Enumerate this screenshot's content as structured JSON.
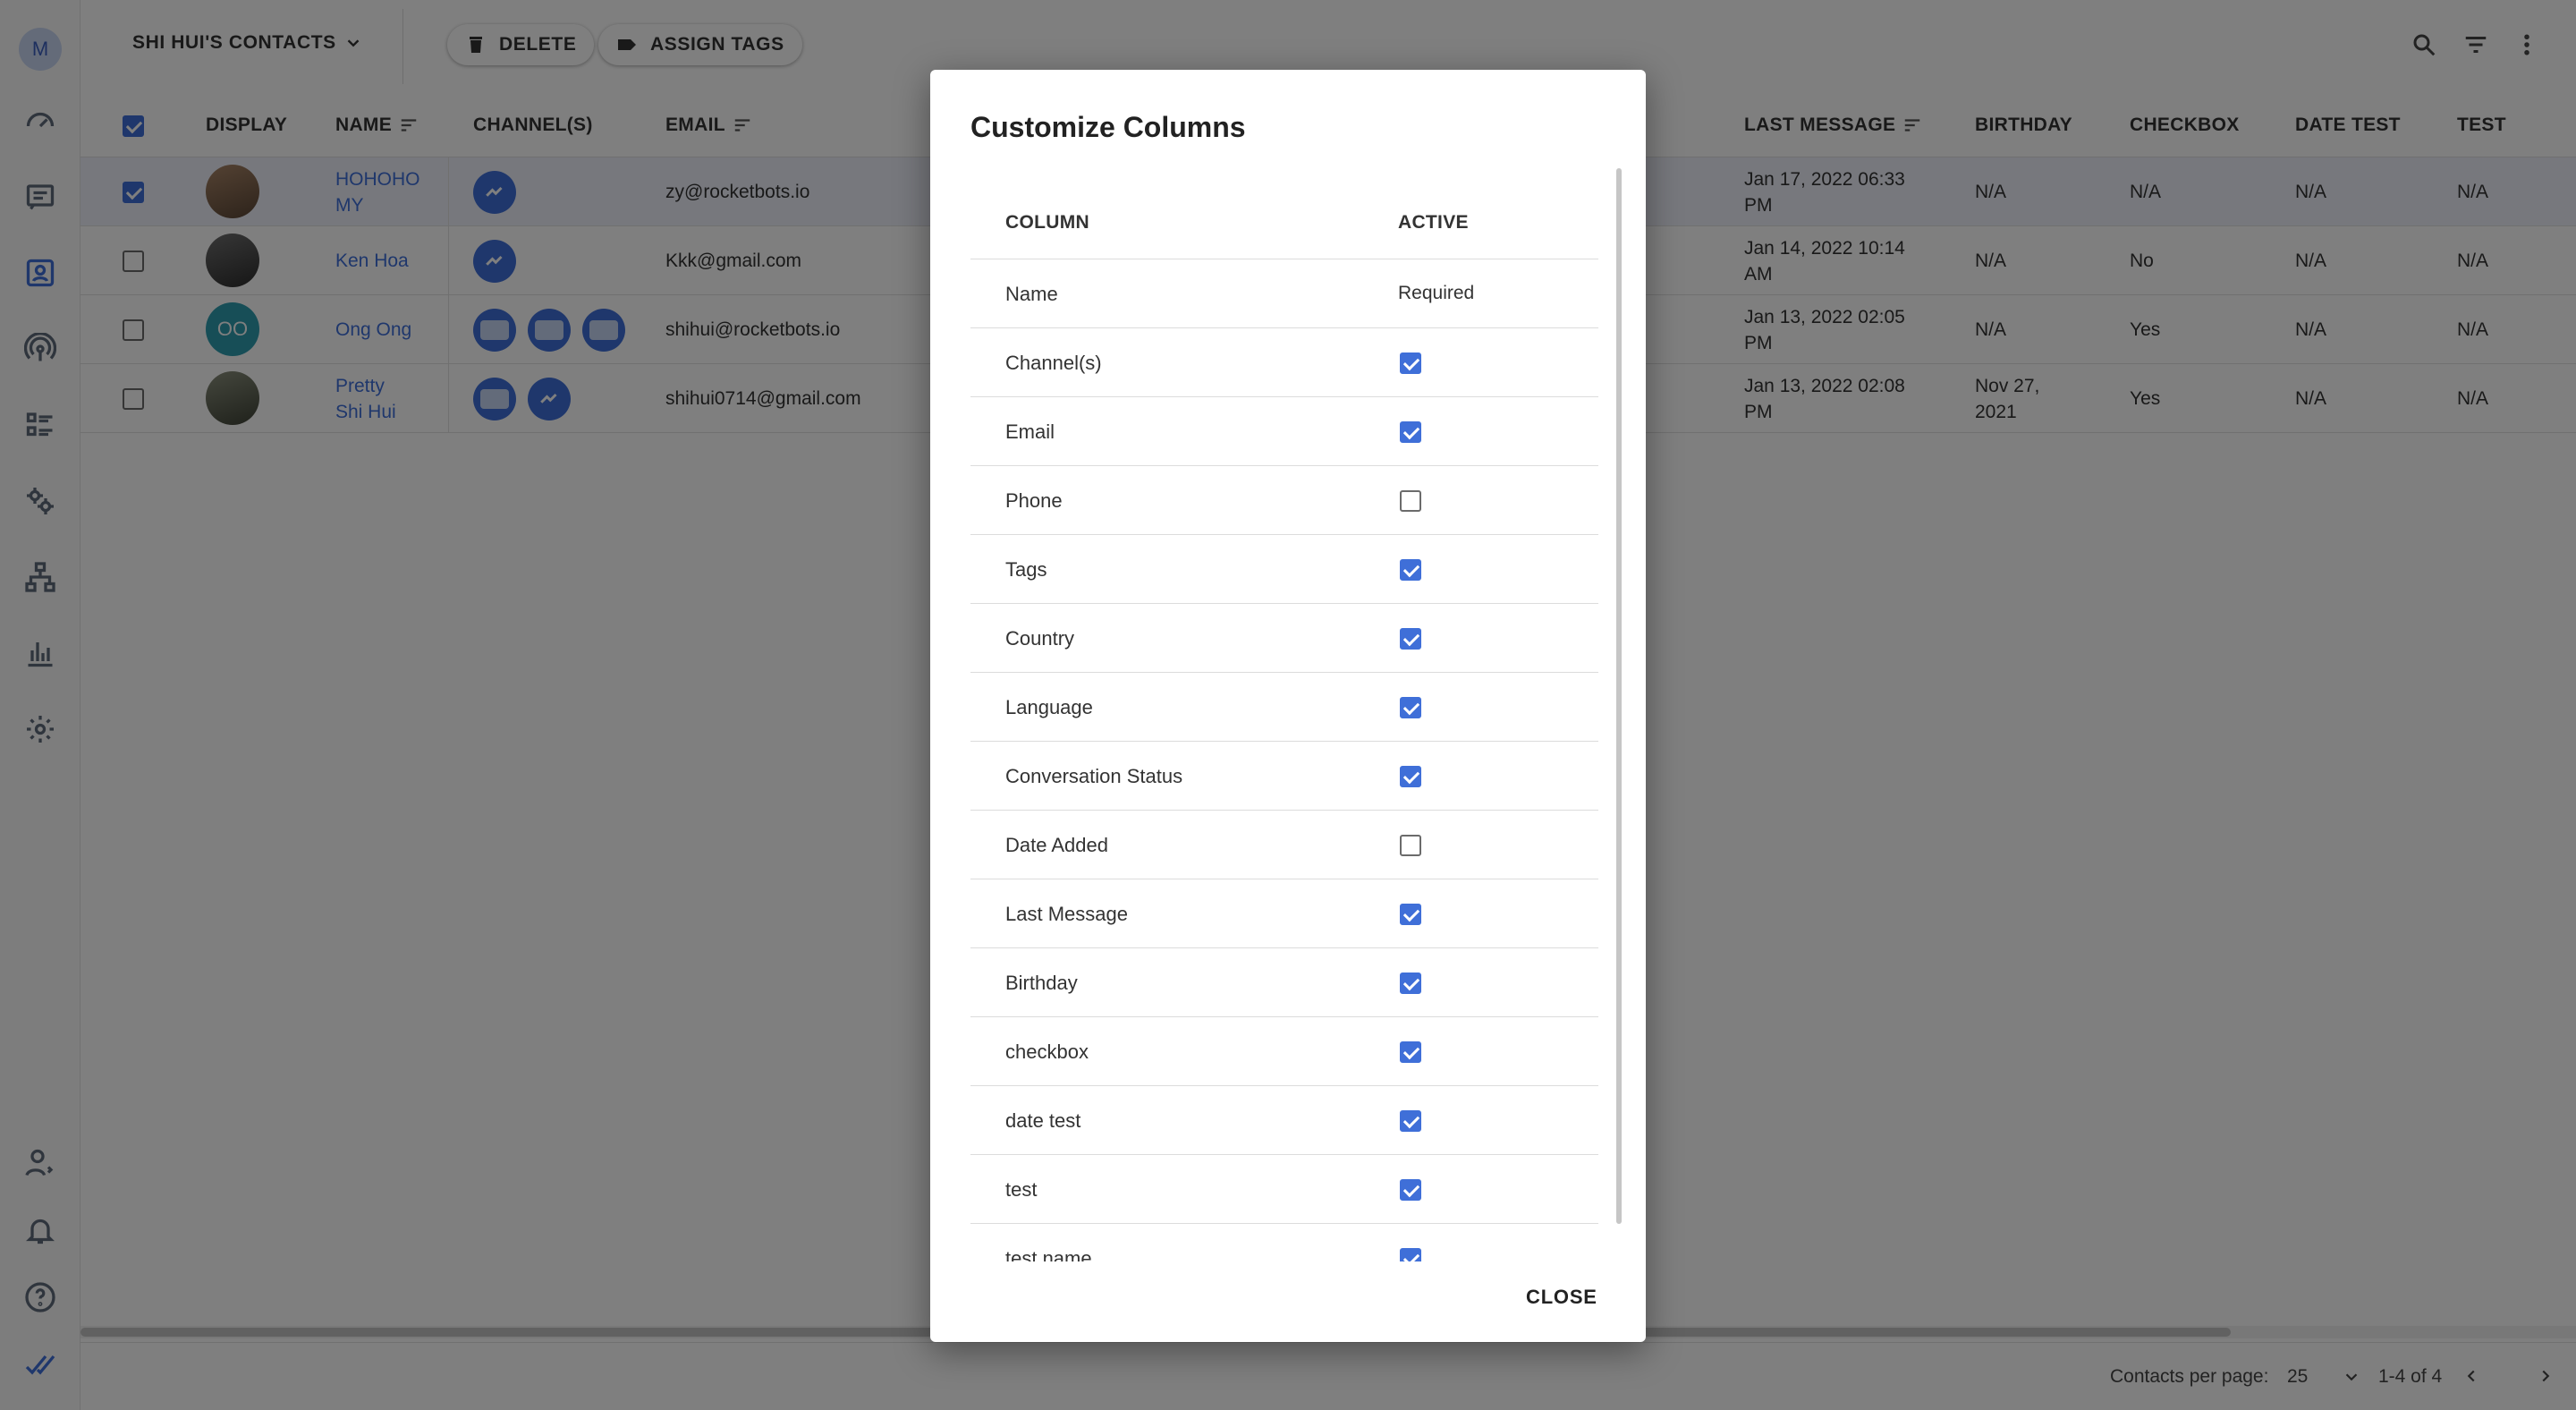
{
  "sidebar": {
    "avatar_letter": "M",
    "icons": [
      "dashboard-icon",
      "inbox-icon",
      "contacts-icon",
      "broadcast-icon",
      "list-icon",
      "integrations-icon",
      "flow-icon",
      "analytics-icon",
      "settings-icon",
      "user-icon",
      "bell-icon",
      "help-icon",
      "brand-logo-icon"
    ]
  },
  "topbar": {
    "contacts_view": "SHI HUI'S CONTACTS",
    "delete_label": "DELETE",
    "assign_tags_label": "ASSIGN TAGS"
  },
  "table": {
    "headers": {
      "display": "DISPLAY",
      "name": "NAME",
      "channels": "CHANNEL(S)",
      "email": "EMAIL",
      "last_message": "LAST MESSAGE",
      "birthday": "BIRTHDAY",
      "checkbox": "CHECKBOX",
      "date_test": "DATE TEST",
      "test": "TEST"
    },
    "rows": [
      {
        "name_line1": "HOHOHO",
        "name_line2": "MY",
        "email": "zy@rocketbots.io",
        "last_message_line1": "Jan 17, 2022 06:33",
        "last_message_line2": "PM",
        "birthday_line1": "N/A",
        "birthday_line2": "",
        "checkbox": "N/A",
        "date_test": "N/A",
        "test": "N/A",
        "selected": true
      },
      {
        "name_line1": "Ken Hoa",
        "name_line2": "",
        "email": "Kkk@gmail.com",
        "last_message_line1": "Jan 14, 2022 10:14",
        "last_message_line2": "AM",
        "birthday_line1": "N/A",
        "birthday_line2": "",
        "checkbox": "No",
        "date_test": "N/A",
        "test": "N/A",
        "selected": false
      },
      {
        "name_line1": "Ong Ong",
        "name_line2": "",
        "initials": "OO",
        "email": "shihui@rocketbots.io",
        "last_message_line1": "Jan 13, 2022 02:05",
        "last_message_line2": "PM",
        "birthday_line1": "N/A",
        "birthday_line2": "",
        "checkbox": "Yes",
        "date_test": "N/A",
        "test": "N/A",
        "selected": false
      },
      {
        "name_line1": "Pretty",
        "name_line2": "Shi Hui",
        "email": "shihui0714@gmail.com",
        "last_message_line1": "Jan 13, 2022 02:08",
        "last_message_line2": "PM",
        "birthday_line1": "Nov 27,",
        "birthday_line2": "2021",
        "checkbox": "Yes",
        "date_test": "N/A",
        "test": "N/A",
        "selected": false
      }
    ]
  },
  "footer": {
    "per_page_label": "Contacts per page:",
    "per_page_value": "25",
    "range": "1-4 of 4"
  },
  "dialog": {
    "title": "Customize Columns",
    "col_header": "COLUMN",
    "active_header": "ACTIVE",
    "required_text": "Required",
    "close_label": "CLOSE",
    "columns": [
      {
        "label": "Name",
        "required": true
      },
      {
        "label": "Channel(s)",
        "active": true
      },
      {
        "label": "Email",
        "active": true
      },
      {
        "label": "Phone",
        "active": false
      },
      {
        "label": "Tags",
        "active": true
      },
      {
        "label": "Country",
        "active": true
      },
      {
        "label": "Language",
        "active": true
      },
      {
        "label": "Conversation Status",
        "active": true
      },
      {
        "label": "Date Added",
        "active": false
      },
      {
        "label": "Last Message",
        "active": true
      },
      {
        "label": "Birthday",
        "active": true
      },
      {
        "label": "checkbox",
        "active": true
      },
      {
        "label": "date test",
        "active": true
      },
      {
        "label": "test",
        "active": true
      },
      {
        "label": "test name",
        "active": true
      }
    ]
  },
  "colors": {
    "accent": "#3f6fd8",
    "overlay": "rgba(0,0,0,0.5)"
  }
}
